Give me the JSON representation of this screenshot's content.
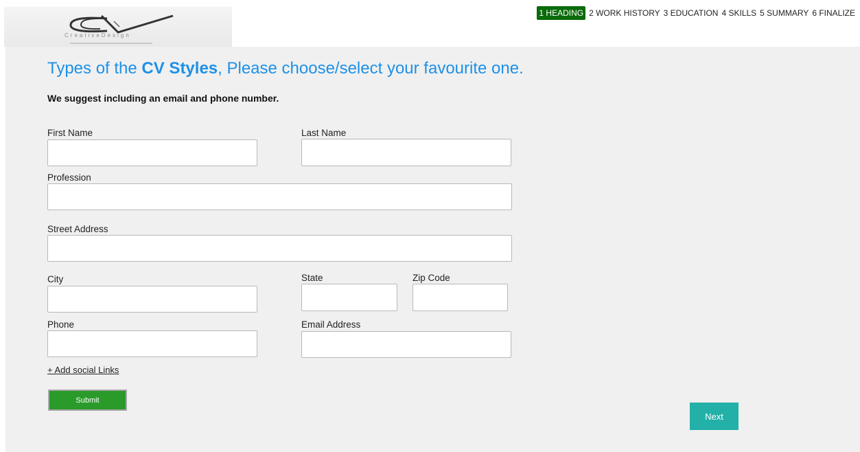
{
  "logo": {
    "name": "CreativeDesign"
  },
  "steps": [
    {
      "label": "1 HEADING",
      "active": true
    },
    {
      "label": "2 WORK HISTORY",
      "active": false
    },
    {
      "label": "3 EDUCATION",
      "active": false
    },
    {
      "label": "4 SKILLS",
      "active": false
    },
    {
      "label": "5 SUMMARY",
      "active": false
    },
    {
      "label": "6 FINALIZE",
      "active": false
    }
  ],
  "page": {
    "title_pre": "Types of the ",
    "title_bold": "CV Styles",
    "title_post": ", Please choose/select your favourite one.",
    "suggestion": "We suggest including an email and phone number."
  },
  "form": {
    "first_name": {
      "label": "First Name",
      "value": "",
      "placeholder": ""
    },
    "last_name": {
      "label": "Last Name",
      "value": "",
      "placeholder": ""
    },
    "profession": {
      "label": "Profession",
      "value": "",
      "placeholder": ""
    },
    "street": {
      "label": "Street Address",
      "value": "",
      "placeholder": ""
    },
    "city": {
      "label": "City",
      "value": "",
      "placeholder": ""
    },
    "state": {
      "label": "State",
      "value": "",
      "placeholder": ""
    },
    "zip": {
      "label": "Zip Code",
      "value": "",
      "placeholder": ""
    },
    "phone": {
      "label": "Phone",
      "value": "",
      "placeholder": ""
    },
    "email": {
      "label": "Email Address",
      "value": "",
      "placeholder": ""
    },
    "social_link": "+ Add social Links",
    "submit_label": "Submit",
    "next_label": "Next"
  },
  "colors": {
    "title_blue": "#1e90e8",
    "active_step_green": "#0a6b0a",
    "submit_green": "#2a9a2a",
    "next_teal": "#23b0a8",
    "panel_bg": "#f0f0f0"
  }
}
